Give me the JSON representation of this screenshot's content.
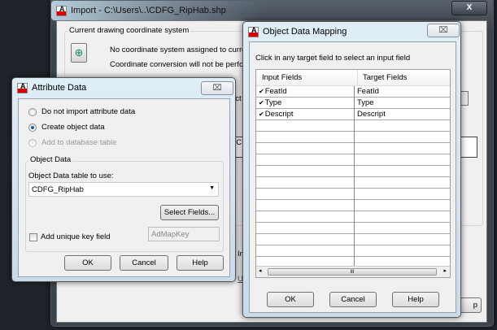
{
  "import_window": {
    "title": "Import - C:\\Users\\..\\CDFG_RipHab.shp",
    "close_label": "X",
    "coord_group_label": "Current drawing coordinate system",
    "coord_msg_1": "No coordinate system assigned to current dr",
    "coord_msg_2": "Coordinate conversion will not be performed",
    "partial_1": "ect",
    "partial_2": "t C",
    "partial_3": "Im",
    "partial_4": "Us",
    "partial_5": "p"
  },
  "attribute_dialog": {
    "title": "Attribute Data",
    "close_label": "⌧",
    "radio_options": [
      {
        "label": "Do not import attribute data",
        "selected": false,
        "enabled": true
      },
      {
        "label": "Create object data",
        "selected": true,
        "enabled": true
      },
      {
        "label": "Add to database table",
        "selected": false,
        "enabled": false
      }
    ],
    "group_label": "Object Data",
    "table_label": "Object Data table to use:",
    "table_value": "CDFG_RipHab",
    "select_fields_label": "Select Fields...",
    "unique_key_label": "Add unique key field",
    "unique_key_checked": false,
    "key_field_value": "AdMapKey",
    "ok_label": "OK",
    "cancel_label": "Cancel",
    "help_label": "Help"
  },
  "mapping_dialog": {
    "title": "Object Data Mapping",
    "close_label": "⌧",
    "instruction": "Click in any target field to select an input field",
    "columns": [
      "Input Fields",
      "Target Fields"
    ],
    "rows": [
      {
        "input": "FeatId",
        "target": "FeatId",
        "checked": true
      },
      {
        "input": "Type",
        "target": "Type",
        "checked": true
      },
      {
        "input": "Descript",
        "target": "Descript",
        "checked": true
      }
    ],
    "empty_rows": 13,
    "scroll_thumb": "III",
    "ok_label": "OK",
    "cancel_label": "Cancel",
    "help_label": "Help"
  }
}
